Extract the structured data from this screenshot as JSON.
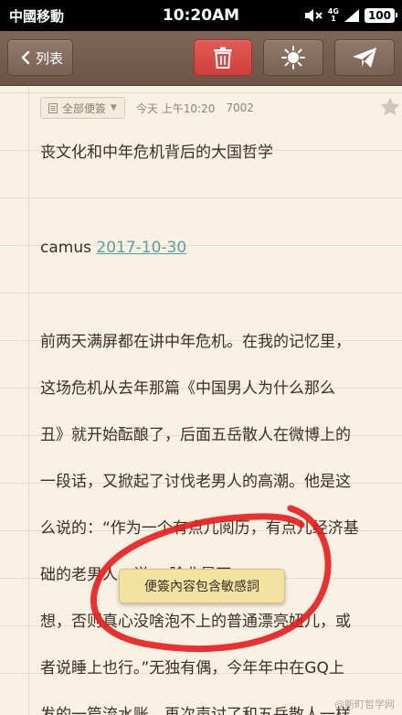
{
  "status_bar": {
    "carrier": "中國移動",
    "time": "10:20AM",
    "network": "4G",
    "network_sub": "1",
    "battery": "100"
  },
  "toolbar": {
    "back_label": "列表"
  },
  "note_meta": {
    "folder": "全部便簽",
    "date": "今天 上午10:20",
    "count": "7002"
  },
  "note": {
    "title": "丧文化和中年危机背后的大国哲学",
    "author": "camus",
    "author_date": "2017-10-30",
    "body_lines": [
      "前两天满屏都在讲中年危机。在我的记忆里，",
      "这场危机从去年那篇《中国男人为什么那么",
      "丑》就开始酝酿了，后面五岳散人在微博上的",
      "一段话，又掀起了讨伐老男人的高潮。他是这",
      "么说的：“作为一个有点儿阅历，有点儿经济基",
      "础的老男人，说。 除非是不",
      "想，否则真心没啥泡不上的普通漂亮妞儿，或",
      "者说睡上也行。”无独有偶，今年年中在GQ上",
      "发的一篇流水账，再次声讨了和五岳散人一样"
    ]
  },
  "toast": {
    "message": "便簽內容包含敏感詞"
  },
  "watermark": "@新町哲学网",
  "colors": {
    "delete_button": "#d9463f",
    "toolbar": "#6e5748",
    "annotation_circle": "#e81c1c",
    "link": "#5f9ea0"
  }
}
